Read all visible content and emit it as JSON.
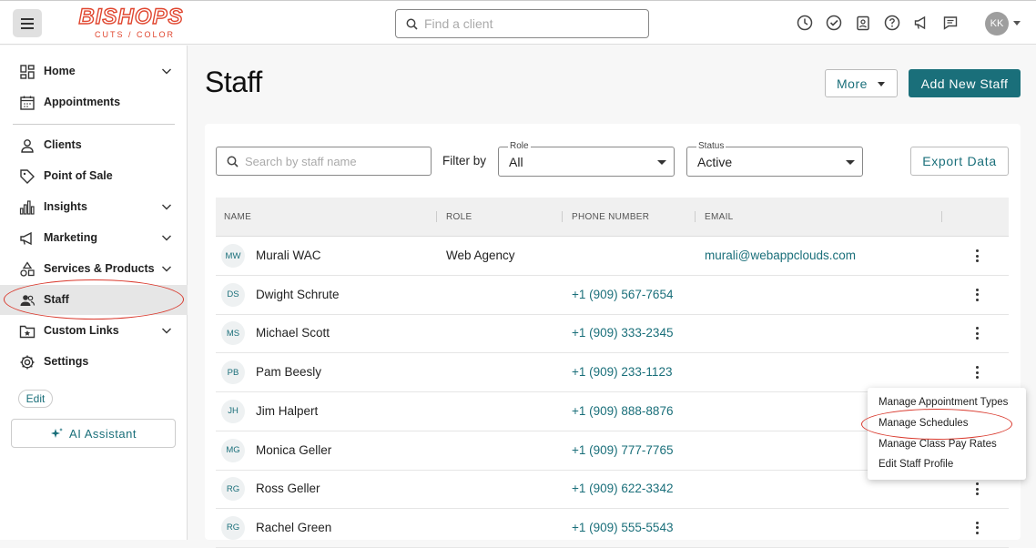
{
  "header": {
    "brand": "BISHOPS",
    "tagline": "CUTS / COLOR",
    "search_placeholder": "Find a client",
    "user_initials": "KK",
    "icons": [
      "clock-icon",
      "check-circle-icon",
      "clipboard-icon",
      "help-icon",
      "megaphone-icon",
      "chat-icon"
    ]
  },
  "sidebar": {
    "items": [
      {
        "label": "Home",
        "icon": "grid-icon",
        "expandable": true
      },
      {
        "label": "Appointments",
        "icon": "calendar-icon",
        "expandable": false
      },
      {
        "label": "Clients",
        "icon": "person-icon",
        "expandable": false
      },
      {
        "label": "Point of Sale",
        "icon": "tag-icon",
        "expandable": false
      },
      {
        "label": "Insights",
        "icon": "bar-chart-icon",
        "expandable": true
      },
      {
        "label": "Marketing",
        "icon": "megaphone-icon",
        "expandable": true
      },
      {
        "label": "Services & Products",
        "icon": "shapes-icon",
        "expandable": true
      },
      {
        "label": "Staff",
        "icon": "people-icon",
        "expandable": false,
        "active": true
      },
      {
        "label": "Custom Links",
        "icon": "star-folder-icon",
        "expandable": true
      },
      {
        "label": "Settings",
        "icon": "gear-icon",
        "expandable": false
      }
    ],
    "edit_label": "Edit",
    "ai_label": "AI Assistant"
  },
  "page": {
    "title": "Staff",
    "more_label": "More",
    "add_label": "Add New Staff"
  },
  "filters": {
    "search_placeholder": "Search by staff name",
    "filter_by": "Filter by",
    "role_label": "Role",
    "role_value": "All",
    "status_label": "Status",
    "status_value": "Active",
    "export_label": "Export Data"
  },
  "table": {
    "columns": [
      "NAME",
      "ROLE",
      "PHONE NUMBER",
      "EMAIL"
    ],
    "rows": [
      {
        "initials": "MW",
        "name": "Murali WAC",
        "role": "Web Agency",
        "phone": "",
        "email": "murali@webappclouds.com"
      },
      {
        "initials": "DS",
        "name": "Dwight Schrute",
        "role": "",
        "phone": "+1 (909) 567-7654",
        "email": ""
      },
      {
        "initials": "MS",
        "name": "Michael Scott",
        "role": "",
        "phone": "+1 (909) 333-2345",
        "email": ""
      },
      {
        "initials": "PB",
        "name": "Pam Beesly",
        "role": "",
        "phone": "+1 (909) 233-1123",
        "email": ""
      },
      {
        "initials": "JH",
        "name": "Jim Halpert",
        "role": "",
        "phone": "+1 (909) 888-8876",
        "email": ""
      },
      {
        "initials": "MG",
        "name": "Monica Geller",
        "role": "",
        "phone": "+1 (909) 777-7765",
        "email": ""
      },
      {
        "initials": "RG",
        "name": "Ross Geller",
        "role": "",
        "phone": "+1 (909) 622-3342",
        "email": ""
      },
      {
        "initials": "RG",
        "name": "Rachel Green",
        "role": "",
        "phone": "+1 (909) 555-5543",
        "email": ""
      }
    ]
  },
  "context_menu": {
    "items": [
      "Manage Appointment Types",
      "Manage Schedules",
      "Manage Class Pay Rates",
      "Edit Staff Profile"
    ]
  },
  "colors": {
    "accent": "#1a6f7a",
    "brand": "#e0452e",
    "annotation": "#d9382c"
  }
}
